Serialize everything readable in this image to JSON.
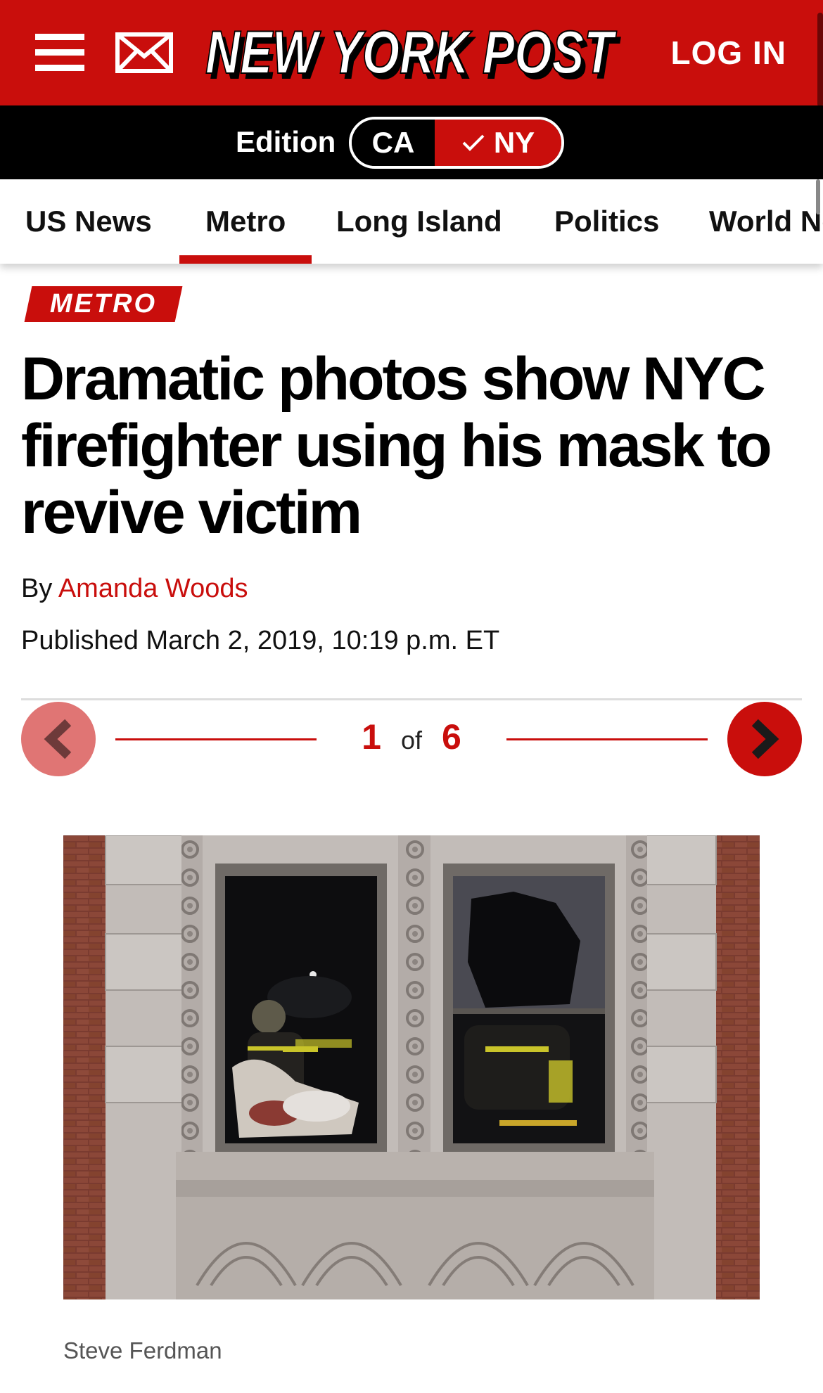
{
  "header": {
    "logo_text": "NEW YORK POST",
    "login_label": "LOG IN"
  },
  "edition": {
    "label": "Edition",
    "options": [
      "CA",
      "NY"
    ],
    "selected": "NY"
  },
  "nav": {
    "items": [
      {
        "label": "US News",
        "active": false
      },
      {
        "label": "Metro",
        "active": true
      },
      {
        "label": "Long Island",
        "active": false
      },
      {
        "label": "Politics",
        "active": false
      },
      {
        "label": "World News",
        "active": false
      }
    ]
  },
  "article": {
    "section": "METRO",
    "headline": "Dramatic photos show NYC firefighter using his mask to revive victim",
    "byline_prefix": "By",
    "author": "Amanda Woods",
    "published": "Published March 2, 2019, 10:19 p.m. ET"
  },
  "gallery": {
    "current": "1",
    "of": "of",
    "total": "6",
    "photo_credit": "Steve Ferdman"
  },
  "colors": {
    "brand_red": "#c90e0c",
    "prev_button": "#e07574",
    "edition_bar": "#000000"
  },
  "icons": {
    "menu": "hamburger-menu-icon",
    "mail": "mail-icon",
    "check": "check-icon",
    "prev": "chevron-left-icon",
    "next": "chevron-right-icon"
  }
}
